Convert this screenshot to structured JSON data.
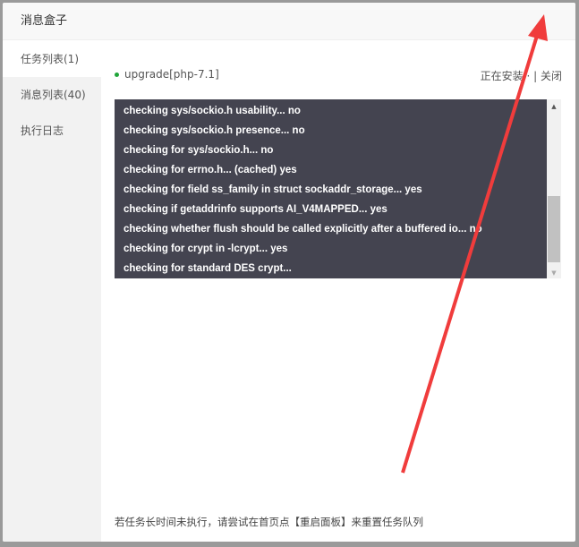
{
  "title": "消息盒子",
  "sidebar": {
    "items": [
      {
        "label": "任务列表(1)",
        "active": true
      },
      {
        "label": "消息列表(40)"
      },
      {
        "label": "执行日志"
      }
    ]
  },
  "task": {
    "name": "upgrade[php-7.1]",
    "status": "正在安装 · ",
    "close": "关闭",
    "status_color": "#20a53a"
  },
  "log": [
    "checking sys/sockio.h usability... no",
    "checking sys/sockio.h presence... no",
    "checking for sys/sockio.h... no",
    "checking for errno.h... (cached) yes",
    "checking for field ss_family in struct sockaddr_storage... yes",
    "checking if getaddrinfo supports AI_V4MAPPED... yes",
    "checking whether flush should be called explicitly after a buffered io... no",
    "checking for crypt in -lcrypt... yes",
    "checking for standard DES crypt..."
  ],
  "footer": "若任务长时间未执行，请尝试在首页点【重启面板】来重置任务队列",
  "annotation": {
    "type": "red-arrow",
    "color": "#f03c3c"
  }
}
